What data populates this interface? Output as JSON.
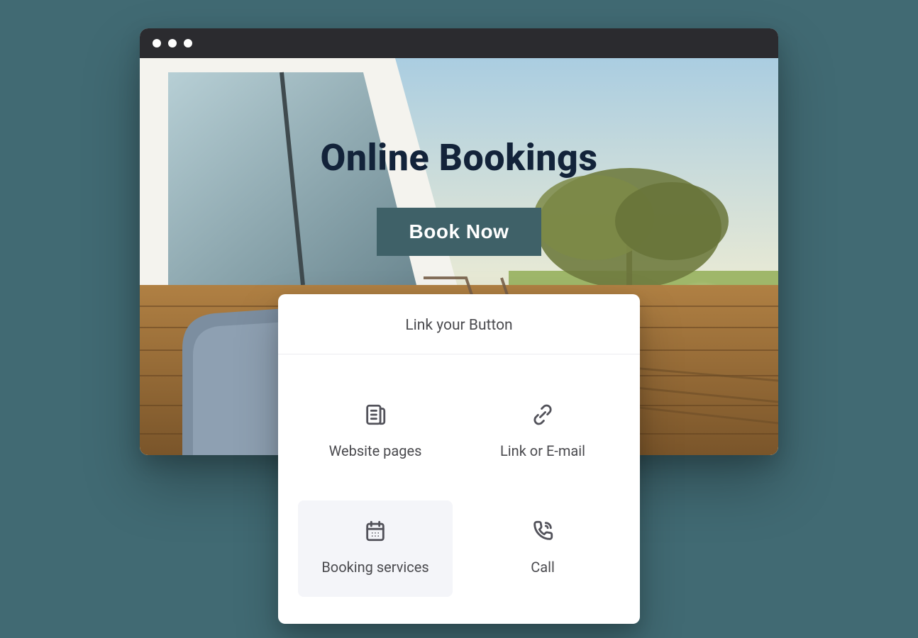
{
  "hero": {
    "title": "Online Bookings",
    "cta_label": "Book Now"
  },
  "panel": {
    "title": "Link your Button",
    "options": [
      {
        "label": "Website pages"
      },
      {
        "label": "Link or E-mail"
      },
      {
        "label": "Booking services"
      },
      {
        "label": "Call"
      }
    ]
  }
}
